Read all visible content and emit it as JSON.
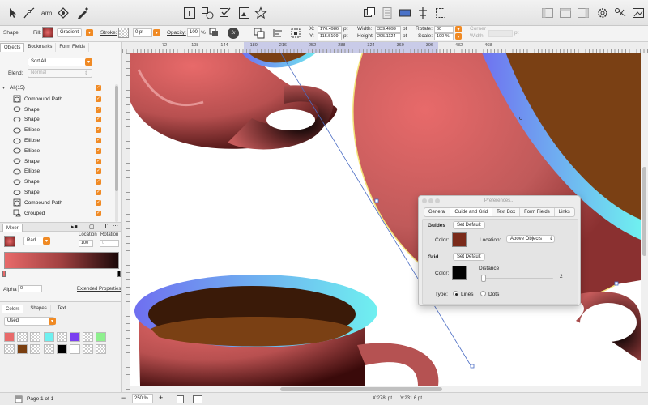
{
  "toolbar": {
    "left_tools": [
      "pointer-icon",
      "path-icon",
      "text-flow-icon",
      "stroke-icon",
      "pen-icon"
    ],
    "center_tools": [
      "text-tool-icon",
      "shapes-icon",
      "checkbox-icon",
      "image-icon",
      "star-icon"
    ],
    "right_tools": [
      "arrange-icon",
      "align-icon",
      "distribute-icon",
      "crop-icon",
      "selection-icon"
    ],
    "far_right_tools": [
      "panel-left-icon",
      "panel-top-icon",
      "panel-right-icon",
      "settings-icon",
      "library-icon",
      "images-icon"
    ]
  },
  "inspector": {
    "shape_label": "Shape:",
    "fill_label": "Fill:",
    "fill_type": "Gradient",
    "stroke_label": "Stroke:",
    "stroke_value": "0 pt",
    "opacity_label": "Opacity:",
    "opacity_value": "100",
    "opacity_unit": "%",
    "fx_label": "fx",
    "x_label": "X:",
    "x_value": "176.4986",
    "y_label": "Y:",
    "y_value": "115.5109",
    "unit_pt": "pt",
    "width_label": "Width:",
    "width_value": "339.4099",
    "height_label": "Height:",
    "height_value": "295.1124",
    "rotate_label": "Rotate:",
    "rotate_value": "60",
    "scale_label": "Scale:",
    "scale_value": "100 %",
    "corner_label": "Corner",
    "corner_width_label": "Width:",
    "corner_unit": "pt"
  },
  "sidebar": {
    "tabs": [
      "Objects",
      "Bookmarks",
      "Form Fields"
    ],
    "sort_label": "Sort All",
    "blend_label": "Blend:",
    "blend_value": "Normal",
    "all_label": "All(15)",
    "layers": [
      {
        "name": "Compound Path",
        "icon": "compound-path-icon"
      },
      {
        "name": "Shape",
        "icon": "shape-icon"
      },
      {
        "name": "Shape",
        "icon": "shape-icon"
      },
      {
        "name": "Ellipse",
        "icon": "ellipse-icon"
      },
      {
        "name": "Ellipse",
        "icon": "ellipse-icon"
      },
      {
        "name": "Ellipse",
        "icon": "ellipse-icon"
      },
      {
        "name": "Shape",
        "icon": "shape-icon"
      },
      {
        "name": "Ellipse",
        "icon": "ellipse-icon"
      },
      {
        "name": "Shape",
        "icon": "shape-icon"
      },
      {
        "name": "Shape",
        "icon": "shape-icon"
      },
      {
        "name": "Compound Path",
        "icon": "compound-path-icon"
      },
      {
        "name": "Grouped",
        "icon": "group-icon"
      }
    ],
    "mixer_label": "Mixer",
    "gradient_type": "Radi...",
    "location_label": "Location",
    "rotation_label": "Rotation",
    "location_value": "100",
    "rotation_value": "0",
    "alpha_label": "Alpha",
    "alpha_value": "0",
    "extended_label": "Extended Properties",
    "color_tabs": [
      "Colors",
      "Shapes",
      "Text"
    ],
    "used_label": "Used",
    "swatches_row1": [
      "#e86a6a",
      "checker",
      "checker",
      "#6ff0f0",
      "checker",
      "#7a3ff0",
      "checker",
      "#8ef08e"
    ],
    "swatches_row2": [
      "checker",
      "#7a3f10",
      "checker",
      "checker",
      "#000000",
      "#ffffff",
      "checker",
      "checker"
    ]
  },
  "ruler": {
    "ticks": [
      "72",
      "108",
      "144",
      "180",
      "216",
      "252",
      "288",
      "324",
      "360",
      "396",
      "432",
      "468"
    ]
  },
  "prefs": {
    "title": "Preferences...",
    "tabs": [
      "General",
      "Guide and Grid",
      "Text Box",
      "Form Fields",
      "Links"
    ],
    "guides_label": "Guides",
    "set_default_label": "Set Default",
    "color_label": "Color:",
    "guide_color": "#7a2a1a",
    "location_label": "Location:",
    "location_value": "Above Objects",
    "grid_label": "Grid",
    "grid_set_default_label": "Set Default",
    "grid_color_label": "Color:",
    "grid_color": "#000000",
    "distance_label": "Distance",
    "distance_value": "2",
    "type_label": "Type:",
    "type_lines": "Lines",
    "type_dots": "Dots"
  },
  "bottom": {
    "page_label": "Page 1 of 1",
    "zoom_value": "250 %",
    "zoom_out": "−",
    "zoom_in": "+",
    "coords_x": "X:278. pt",
    "coords_y": "Y:231.6 pt"
  },
  "colors": {
    "accent": "#f08a24",
    "cup_red": "#c65c5c",
    "coffee": "#7a4014",
    "rim_blue": "#6f6ff0",
    "rim_cyan": "#6ff0f0"
  }
}
